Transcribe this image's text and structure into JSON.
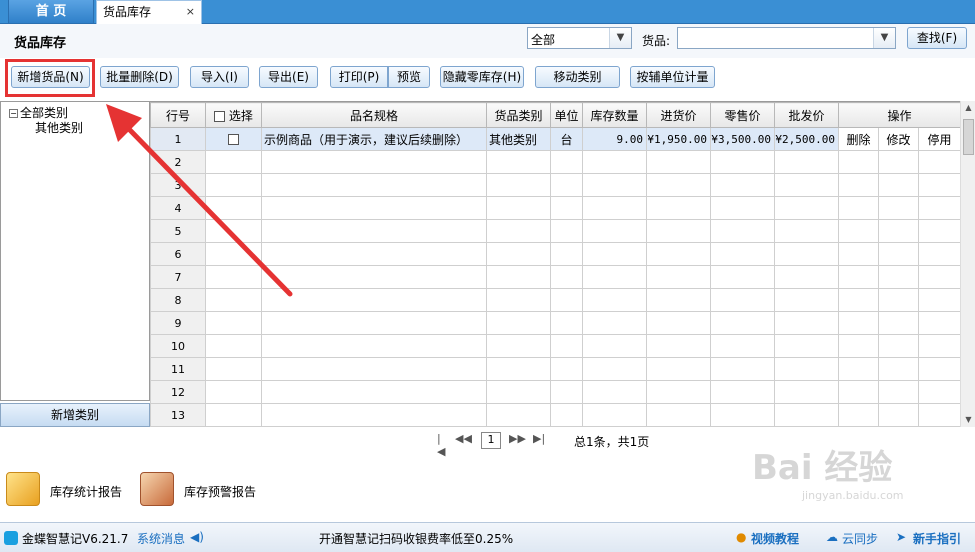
{
  "tabs": {
    "home": "首 页",
    "active": "货品库存",
    "close": "×"
  },
  "header": {
    "title": "货品库存",
    "category_value": "全部",
    "goods_label": "货品:",
    "goods_value": "",
    "search_btn": "查找(F)"
  },
  "toolbar": {
    "add": "新增货品(N)",
    "batch_delete": "批量删除(D)",
    "import": "导入(I)",
    "export": "导出(E)",
    "print": "打印(P)",
    "preview": "预览",
    "hide_zero": "隐藏零库存(H)",
    "move_category": "移动类别",
    "aux_unit": "按辅单位计量"
  },
  "tree": {
    "root": "全部类别",
    "child": "其他类别",
    "add_category": "新增类别"
  },
  "grid": {
    "headers": [
      "行号",
      "选择",
      "品名规格",
      "货品类别",
      "单位",
      "库存数量",
      "进货价",
      "零售价",
      "批发价",
      "操作"
    ],
    "row1": {
      "no": "1",
      "name": "示例商品（用于演示，建议后续删除）",
      "category": "其他类别",
      "unit": "台",
      "qty": "9.00",
      "purchase": "¥1,950.00",
      "retail": "¥3,500.00",
      "wholesale": "¥2,500.00",
      "op_delete": "删除",
      "op_edit": "修改",
      "op_disable": "停用"
    },
    "row_numbers": [
      "2",
      "3",
      "4",
      "5",
      "6",
      "7",
      "8",
      "9",
      "10",
      "11",
      "12",
      "13"
    ]
  },
  "pager": {
    "first": "|◀",
    "prev": "◀◀",
    "page": "1",
    "next": "▶▶",
    "last": "▶|",
    "total": "总1条，共1页"
  },
  "reports": {
    "stats": "库存统计报告",
    "warning": "库存预警报告"
  },
  "statusbar": {
    "version": "金蝶智慧记V6.21.7",
    "sys_msg": "系统消息",
    "notice": "开通智慧记扫码收银费率低至0.25%",
    "video": "视频教程",
    "cloud": "云同步",
    "guide": "新手指引"
  },
  "watermark": {
    "text": "Bai 经验",
    "sub": "jingyan.baidu.com"
  },
  "colors": {
    "accent": "#3a8fd4",
    "highlight": "#e53333"
  }
}
